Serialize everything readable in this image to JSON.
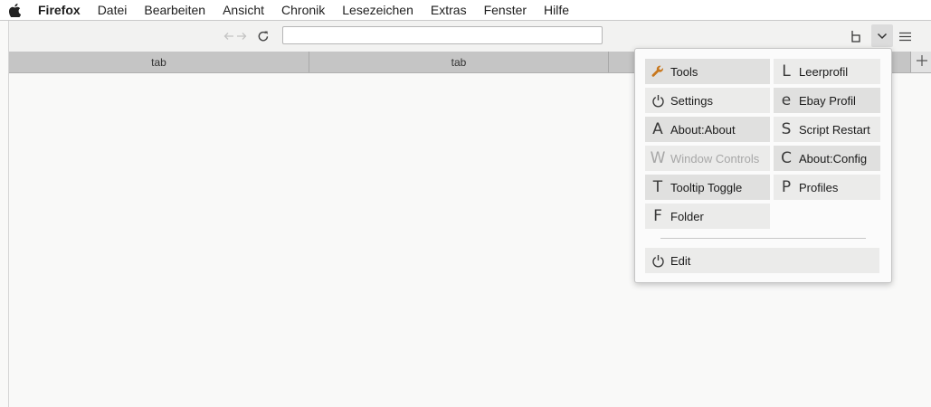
{
  "menubar": {
    "app_name": "Firefox",
    "items": [
      "Datei",
      "Bearbeiten",
      "Ansicht",
      "Chronik",
      "Lesezeichen",
      "Extras",
      "Fenster",
      "Hilfe"
    ]
  },
  "navbar": {
    "url_value": "",
    "icons": [
      "back-arrow-icon",
      "forward-arrow-icon",
      "reload-icon",
      "b-icon",
      "chevron-down-icon",
      "hamburger-menu-icon"
    ]
  },
  "tabs": [
    {
      "label": "tab"
    },
    {
      "label": "tab"
    }
  ],
  "panel": {
    "left": [
      {
        "label": "Tools",
        "icon": "wrench-icon"
      },
      {
        "label": "Settings",
        "icon": "power-icon"
      },
      {
        "label": "About:About",
        "icon": "A"
      },
      {
        "label": "Window Controls",
        "icon": "W"
      },
      {
        "label": "Tooltip Toggle",
        "icon": "T"
      },
      {
        "label": "Folder",
        "icon": "F"
      }
    ],
    "right": [
      {
        "label": "Leerprofil",
        "icon": "L"
      },
      {
        "label": "Ebay Profil",
        "icon": "e"
      },
      {
        "label": "Script Restart",
        "icon": "S"
      },
      {
        "label": "About:Config",
        "icon": "C"
      },
      {
        "label": "Profiles",
        "icon": "P"
      }
    ],
    "edit": {
      "label": "Edit",
      "icon": "power-icon"
    }
  },
  "colors": {
    "wrench": "#c8781e",
    "panel_item": "#ebebea",
    "panel_item_highlight": "#e0e0df"
  }
}
